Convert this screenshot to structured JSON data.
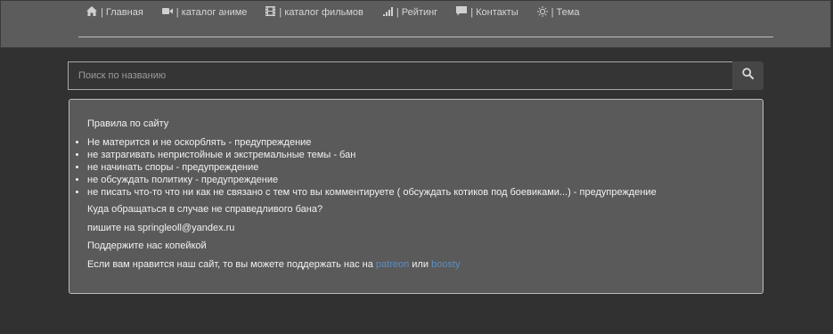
{
  "nav": {
    "items": [
      {
        "icon": "home-icon",
        "label": "| Главная"
      },
      {
        "icon": "video-camera-icon",
        "label": "| каталог аниме"
      },
      {
        "icon": "film-icon",
        "label": "| каталог фильмов"
      },
      {
        "icon": "signal-bars-icon",
        "label": "| Рейтинг"
      },
      {
        "icon": "comment-icon",
        "label": "| Контакты"
      },
      {
        "icon": "sun-icon",
        "label": "| Тема"
      }
    ]
  },
  "search": {
    "placeholder": "Поиск по названию",
    "button_icon": "search-icon"
  },
  "rules": {
    "title": "Правила по сайту",
    "items": [
      "Не матерится и не оскорблять - предупреждение",
      "не затрагивать непристойные и экстремальные темы - бан",
      "не начинать споры - предупреждение",
      "не обсуждать политику - предупреждение",
      "не писать что-то что ни как не связано с тем что вы комментируете ( обсуждать котиков под боевиками...) - предупреждение"
    ],
    "unban_question": "Куда обращаться в случае не справедливого бана?",
    "contact": "пишите на springleoll@yandex.ru",
    "support_heading": "Поддержите нас копейкой",
    "support_text": "Если вам нравится наш сайт, то вы можете поддержать нас на",
    "support_link1": "patreon",
    "support_or": "или",
    "support_link2": "boosty"
  },
  "colors": {
    "background": "#313131",
    "header": "#5c5c5c",
    "panel": "#5a5a5a",
    "link": "#5b8fc4"
  }
}
